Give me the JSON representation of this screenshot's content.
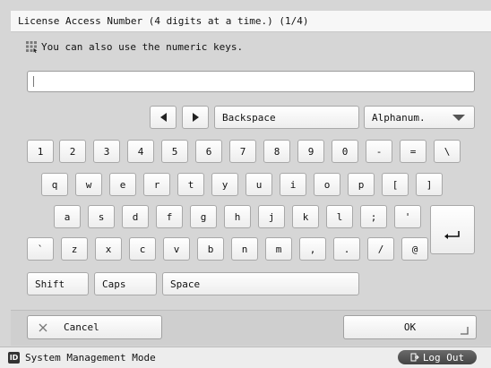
{
  "title": "License Access Number (4 digits at a time.) (1/4)",
  "hint": "You can also use the numeric keys.",
  "input_value": "",
  "controls": {
    "backspace": "Backspace",
    "mode_select": "Alphanum."
  },
  "keys": {
    "row1": [
      "1",
      "2",
      "3",
      "4",
      "5",
      "6",
      "7",
      "8",
      "9",
      "0",
      "-",
      "=",
      "\\"
    ],
    "row2": [
      "q",
      "w",
      "e",
      "r",
      "t",
      "y",
      "u",
      "i",
      "o",
      "p",
      "[",
      "]"
    ],
    "row3": [
      "a",
      "s",
      "d",
      "f",
      "g",
      "h",
      "j",
      "k",
      "l",
      ";",
      "'"
    ],
    "row4": [
      "`",
      "z",
      "x",
      "c",
      "v",
      "b",
      "n",
      "m",
      ",",
      ".",
      "/",
      "@"
    ]
  },
  "row5": {
    "shift": "Shift",
    "caps": "Caps",
    "space": "Space"
  },
  "buttons": {
    "cancel": "Cancel",
    "ok": "OK"
  },
  "status": {
    "id_badge": "ID",
    "mode": "System Management Mode",
    "logout": "Log Out"
  }
}
